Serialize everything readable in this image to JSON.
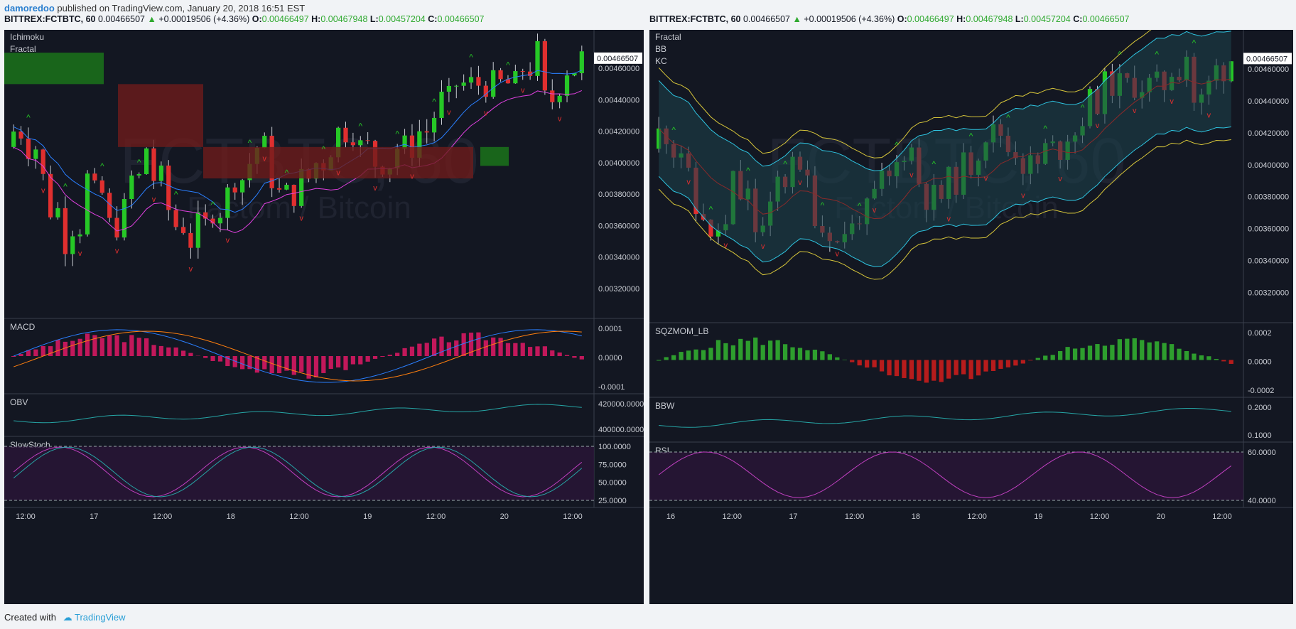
{
  "publish": {
    "user": "damoredoo",
    "text": "published on TradingView.com, January 20, 2018 16:51 EST"
  },
  "header": {
    "symbol": "BITTREX:FCTBTC, 60",
    "price": "0.00466507",
    "change": "+0.00019506 (+4.36%)",
    "o_label": "O:",
    "o": "0.00466497",
    "h_label": "H:",
    "h": "0.00467948",
    "l_label": "L:",
    "l": "0.00457204",
    "c_label": "C:",
    "c": "0.00466507"
  },
  "watermark": {
    "symbol": "FCTBTC, 60",
    "name": "Factom / Bitcoin"
  },
  "colors": {
    "bg": "#131722",
    "up": "#26c826",
    "down": "#e02f2f",
    "axis_text": "#c8cbd2",
    "grid": "#2a2e39",
    "label_bg": "#ffffff"
  },
  "left": {
    "main_labels": [
      "Ichimoku",
      "Fractal"
    ],
    "price_ticks": [
      "0.00460000",
      "0.00440000",
      "0.00420000",
      "0.00400000",
      "0.00380000",
      "0.00360000",
      "0.00340000",
      "0.00320000"
    ],
    "last_price_label": "0.00466507",
    "panes": [
      {
        "label": "MACD",
        "ticks": [
          "0.0001",
          "0.0000",
          "-0.0001"
        ]
      },
      {
        "label": "OBV",
        "ticks": [
          "420000.0000",
          "400000.0000"
        ]
      },
      {
        "label": "SlowStoch",
        "ticks": [
          "100.0000",
          "75.0000",
          "50.0000",
          "25.0000"
        ]
      }
    ],
    "time_ticks": [
      "12:00",
      "17",
      "12:00",
      "18",
      "12:00",
      "19",
      "12:00",
      "20",
      "12:00"
    ]
  },
  "right": {
    "main_labels": [
      "Fractal",
      "BB",
      "KC"
    ],
    "price_ticks": [
      "0.00460000",
      "0.00440000",
      "0.00420000",
      "0.00400000",
      "0.00380000",
      "0.00360000",
      "0.00340000",
      "0.00320000"
    ],
    "last_price_label": "0.00466507",
    "panes": [
      {
        "label": "SQZMOM_LB",
        "ticks": [
          "0.0002",
          "0.0000",
          "-0.0002"
        ]
      },
      {
        "label": "BBW",
        "ticks": [
          "0.2000",
          "0.1000"
        ]
      },
      {
        "label": "RSI",
        "ticks": [
          "60.0000",
          "40.0000"
        ]
      }
    ],
    "time_ticks": [
      "16",
      "12:00",
      "17",
      "12:00",
      "18",
      "12:00",
      "19",
      "12:00",
      "20",
      "12:00"
    ]
  },
  "footer": {
    "created_with": "Created with",
    "brand": "TradingView"
  },
  "chart_data": [
    {
      "type": "candlestick",
      "title": "BITTREX:FCTBTC, 60",
      "indicators": [
        "Ichimoku",
        "Fractal",
        "MACD",
        "OBV",
        "SlowStoch"
      ],
      "ylim": [
        0.0031,
        0.0048
      ],
      "close": [
        0.0042,
        0.0041,
        0.0039,
        0.0037,
        0.0035,
        0.0036,
        0.0039,
        0.0038,
        0.0036,
        0.0037,
        0.0039,
        0.0041,
        0.0039,
        0.0037,
        0.0036,
        0.0035,
        0.0036,
        0.0037,
        0.0038,
        0.0039,
        0.004,
        0.0041,
        0.0039,
        0.0038,
        0.0038,
        0.0039,
        0.004,
        0.0041,
        0.0042,
        0.0042,
        0.0041,
        0.004,
        0.004,
        0.0041,
        0.0041,
        0.0042,
        0.0043,
        0.0044,
        0.0045,
        0.0045,
        0.0045,
        0.0045,
        0.0045,
        0.0045,
        0.0046,
        0.0047,
        0.0044,
        0.0045,
        0.0046,
        0.004665
      ],
      "last": 0.00466507
    },
    {
      "type": "candlestick",
      "title": "BITTREX:FCTBTC, 60",
      "indicators": [
        "Fractal",
        "BB",
        "KC",
        "SQZMOM_LB",
        "BBW",
        "RSI"
      ],
      "ylim": [
        0.0031,
        0.0048
      ],
      "close": [
        0.0042,
        0.0041,
        0.0039,
        0.0037,
        0.0035,
        0.0036,
        0.0039,
        0.0038,
        0.0036,
        0.0037,
        0.0039,
        0.0041,
        0.0039,
        0.0037,
        0.0036,
        0.0035,
        0.0036,
        0.0037,
        0.0038,
        0.0039,
        0.004,
        0.0041,
        0.0039,
        0.0038,
        0.0038,
        0.0039,
        0.004,
        0.0041,
        0.0042,
        0.0042,
        0.0041,
        0.004,
        0.004,
        0.0041,
        0.0041,
        0.0042,
        0.0043,
        0.0044,
        0.0045,
        0.0045,
        0.0045,
        0.0045,
        0.0045,
        0.0045,
        0.0046,
        0.0047,
        0.0044,
        0.0045,
        0.0046,
        0.004665
      ],
      "last": 0.00466507
    }
  ]
}
